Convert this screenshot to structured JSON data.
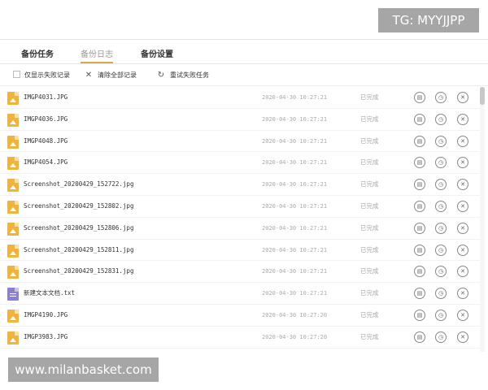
{
  "watermarks": {
    "top": "TG: MYYJJPP",
    "bottom": "www.milanbasket.com"
  },
  "tabs": [
    {
      "label": "备份任务",
      "active": false
    },
    {
      "label": "备份日志",
      "active": true
    },
    {
      "label": "备份设置",
      "active": false
    }
  ],
  "toolbar": {
    "only_failed_label": "仅显示失败记录",
    "clear_all_label": "清除全部记录",
    "retry_failed_label": "重试失败任务"
  },
  "rows": [
    {
      "name": "IMGP4031.JPG",
      "time": "2020-04-30 10:27:21",
      "status": "已完成",
      "type": "image"
    },
    {
      "name": "IMGP4036.JPG",
      "time": "2020-04-30 10:27:21",
      "status": "已完成",
      "type": "image"
    },
    {
      "name": "IMGP4048.JPG",
      "time": "2020-04-30 10:27:21",
      "status": "已完成",
      "type": "image"
    },
    {
      "name": "IMGP4054.JPG",
      "time": "2020-04-30 10:27:21",
      "status": "已完成",
      "type": "image"
    },
    {
      "name": "Screenshot_20200429_152722.jpg",
      "time": "2020-04-30 10:27:21",
      "status": "已完成",
      "type": "image"
    },
    {
      "name": "Screenshot_20200429_152802.jpg",
      "time": "2020-04-30 10:27:21",
      "status": "已完成",
      "type": "image"
    },
    {
      "name": "Screenshot_20200429_152806.jpg",
      "time": "2020-04-30 10:27:21",
      "status": "已完成",
      "type": "image"
    },
    {
      "name": "Screenshot_20200429_152811.jpg",
      "time": "2020-04-30 10:27:21",
      "status": "已完成",
      "type": "image"
    },
    {
      "name": "Screenshot_20200429_152831.jpg",
      "time": "2020-04-30 10:27:21",
      "status": "已完成",
      "type": "image"
    },
    {
      "name": "新建文本文档.txt",
      "time": "2020-04-30 10:27:21",
      "status": "已完成",
      "type": "text"
    },
    {
      "name": "IMGP4190.JPG",
      "time": "2020-04-30 10:27:20",
      "status": "已完成",
      "type": "image"
    },
    {
      "name": "IMGP3983.JPG",
      "time": "2020-04-30 10:27:20",
      "status": "已完成",
      "type": "image"
    }
  ],
  "row_actions": [
    "open-folder-icon",
    "view-icon",
    "delete-icon"
  ],
  "colors": {
    "tab_underline": "#d9a84a",
    "image_icon": "#f2b33d",
    "text_icon": "#8a7fd1"
  }
}
